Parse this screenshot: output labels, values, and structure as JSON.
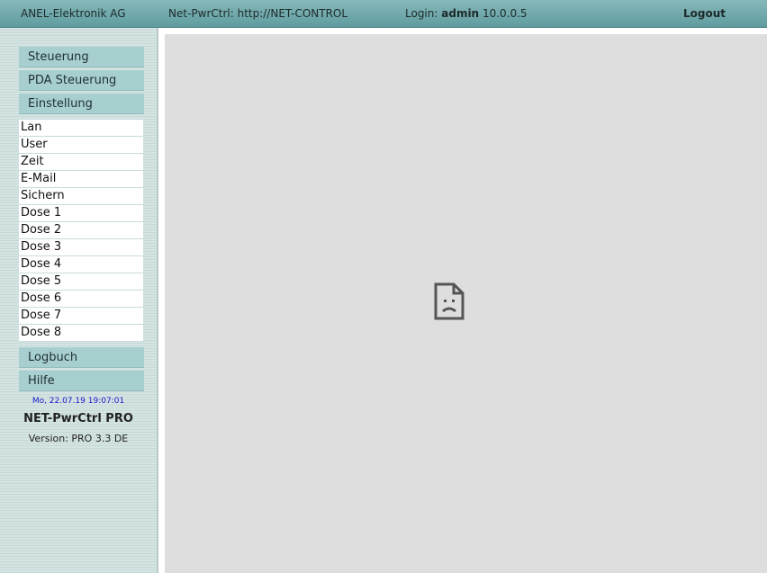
{
  "header": {
    "company": "ANEL-Elektronik AG",
    "device": "Net-PwrCtrl: http://NET-CONTROL",
    "login_label": "Login:",
    "login_user": "admin",
    "login_ip": "10.0.0.5",
    "logout": "Logout"
  },
  "sidebar": {
    "main_items": [
      "Steuerung",
      "PDA Steuerung",
      "Einstellung"
    ],
    "sub_items": [
      "Lan",
      "User",
      "Zeit",
      "E-Mail",
      "Sichern",
      "Dose 1",
      "Dose 2",
      "Dose 3",
      "Dose 4",
      "Dose 5",
      "Dose 6",
      "Dose 7",
      "Dose 8"
    ],
    "bottom_items": [
      "Logbuch",
      "Hilfe"
    ],
    "datetime": "Mo, 22.07.19 19:07:01",
    "product": "NET-PwrCtrl PRO",
    "version_label": "Version:",
    "version_value": "PRO 3.3 DE"
  },
  "content": {
    "icon": "broken-page-icon"
  },
  "colors": {
    "header": "#6fa8aa",
    "nav_button": "#a8cfd0",
    "content_bg": "#dedede",
    "datetime": "#1a1acc"
  }
}
